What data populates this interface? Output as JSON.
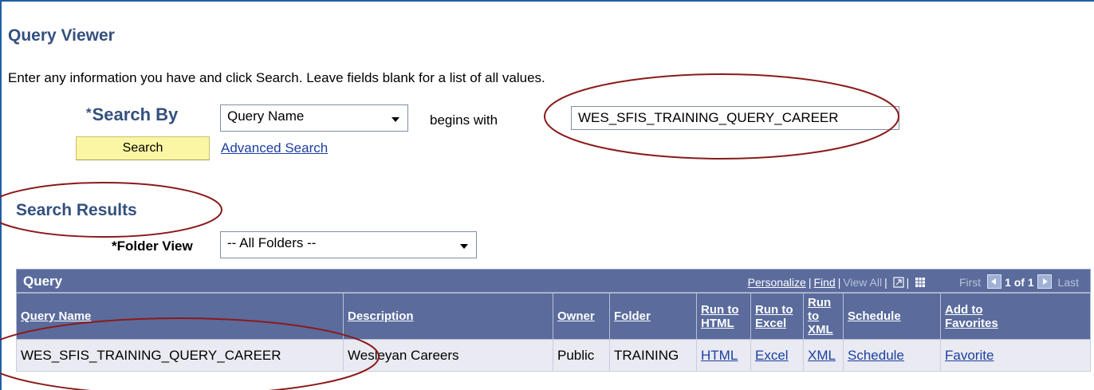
{
  "page_title": "Query Viewer",
  "instructions": "Enter any information you have and click Search. Leave fields blank for a list of all values.",
  "search": {
    "required_mark": "*",
    "label": "Search By",
    "field_selected": "Query Name",
    "operator": "begins with",
    "value": "WES_SFIS_TRAINING_QUERY_CAREER",
    "search_button": "Search",
    "advanced_link": "Advanced Search"
  },
  "results": {
    "heading": "Search Results",
    "folder_view_label": "*Folder View",
    "folder_view_selected": "-- All Folders --",
    "grid": {
      "caption": "Query",
      "personalize": "Personalize",
      "find": "Find",
      "view_all": "View All",
      "first": "First",
      "page_info": "1 of 1",
      "last": "Last",
      "columns": {
        "query_name": "Query Name",
        "description": "Description",
        "owner": "Owner",
        "folder": "Folder",
        "run_html_1": "Run to",
        "run_html_2": "HTML",
        "run_excel_1": "Run to",
        "run_excel_2": "Excel",
        "run_xml_1": "Run to",
        "run_xml_2": "XML",
        "schedule": "Schedule",
        "favorites_1": "Add to",
        "favorites_2": "Favorites"
      },
      "rows": [
        {
          "query_name": "WES_SFIS_TRAINING_QUERY_CAREER",
          "description": "Wesleyan Careers",
          "owner": "Public",
          "folder": "TRAINING",
          "html": "HTML",
          "excel": "Excel",
          "xml": "XML",
          "schedule": "Schedule",
          "favorite": "Favorite"
        }
      ]
    }
  },
  "colors": {
    "heading": "#34507e",
    "grid_header": "#5a6b9c",
    "link": "#1d3fa0",
    "annotation": "#8b1a1a",
    "search_button": "#fbf6a3"
  }
}
